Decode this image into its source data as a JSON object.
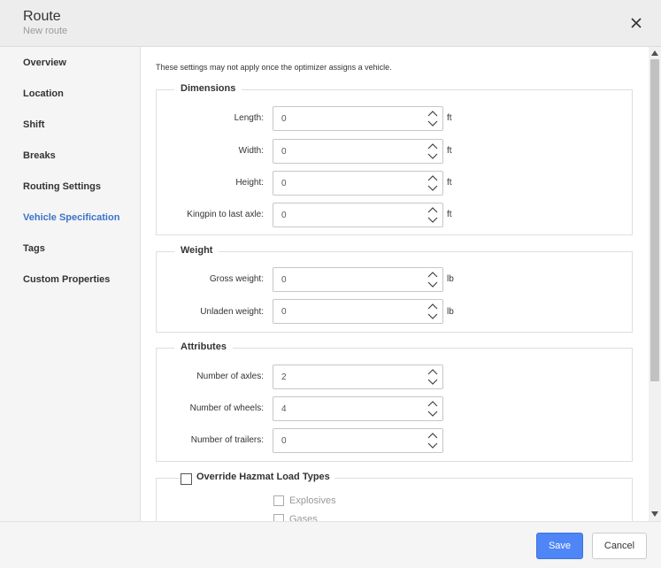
{
  "header": {
    "title": "Route",
    "subtitle": "New route",
    "close_icon": "close-icon"
  },
  "sidebar": {
    "items": [
      {
        "label": "Overview",
        "active": false
      },
      {
        "label": "Location",
        "active": false
      },
      {
        "label": "Shift",
        "active": false
      },
      {
        "label": "Breaks",
        "active": false
      },
      {
        "label": "Routing Settings",
        "active": false
      },
      {
        "label": "Vehicle Specification",
        "active": true
      },
      {
        "label": "Tags",
        "active": false
      },
      {
        "label": "Custom Properties",
        "active": false
      }
    ]
  },
  "main": {
    "notice": "These settings may not apply once the optimizer assigns a vehicle.",
    "dimensions": {
      "title": "Dimensions",
      "fields": [
        {
          "label": "Length:",
          "value": "0",
          "unit": "ft"
        },
        {
          "label": "Width:",
          "value": "0",
          "unit": "ft"
        },
        {
          "label": "Height:",
          "value": "0",
          "unit": "ft"
        },
        {
          "label": "Kingpin to last axle:",
          "value": "0",
          "unit": "ft"
        }
      ]
    },
    "weight": {
      "title": "Weight",
      "fields": [
        {
          "label": "Gross weight:",
          "value": "0",
          "unit": "lb"
        },
        {
          "label": "Unladen weight:",
          "value": "0",
          "unit": "lb"
        }
      ]
    },
    "attributes": {
      "title": "Attributes",
      "fields": [
        {
          "label": "Number of axles:",
          "value": "2"
        },
        {
          "label": "Number of wheels:",
          "value": "4"
        },
        {
          "label": "Number of trailers:",
          "value": "0"
        }
      ]
    },
    "hazmat": {
      "title": "Override Hazmat Load Types",
      "checked": false,
      "options": [
        {
          "label": "Explosives",
          "checked": false
        },
        {
          "label": "Gases",
          "checked": false
        }
      ]
    }
  },
  "footer": {
    "save_label": "Save",
    "cancel_label": "Cancel"
  },
  "colors": {
    "accent": "#4f86f7",
    "active_nav": "#3b73c9",
    "header_bg": "#ededed"
  }
}
